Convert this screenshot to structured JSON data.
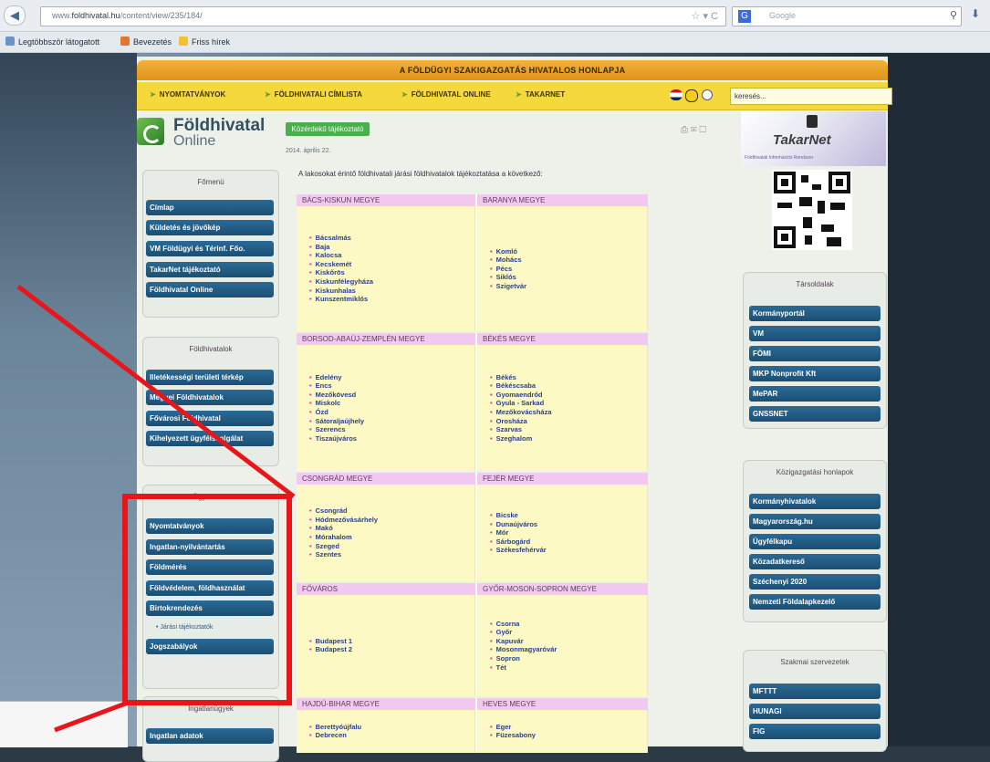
{
  "browser": {
    "back_icon": "back-arrow-icon",
    "url_prefix": "www.",
    "url_domain": "foldhivatal.hu",
    "url_path": "/content/view/235/184/",
    "search_placeholder": "Google",
    "search_engine_icon": "G",
    "bookmarks": [
      "Legtöbbször látogatott",
      "Bevezetés",
      "Friss hírek"
    ]
  },
  "site": {
    "banner": "A FÖLDÜGYI SZAKIGAZGATÁS HIVATALOS HONLAPJA",
    "menu": [
      "NYOMTATVÁNYOK",
      "FÖLDHIVATALI CÍMLISTA",
      "FÖLDHIVATAL ONLINE",
      "TAKARNET"
    ],
    "search_value": "keresés...",
    "logo": {
      "title": "Földhivatal",
      "subtitle": "Online"
    }
  },
  "left_sidebar": {
    "boxes": [
      {
        "title": "Főmenü",
        "items": [
          "Címlap",
          "Küldetés és jövőkép",
          "VM Földügyi és Térinf. Főo.",
          "TakarNet tájékoztató",
          "Földhivatal Online"
        ]
      },
      {
        "title": "Földhivatalok",
        "items": [
          "Illetékességi területi térkép",
          "Megyei Földhivatalok",
          "Fővárosi Földhivatal",
          "Kihelyezett ügyfélszolgálat"
        ]
      },
      {
        "title": "Ügyintézés",
        "items": [
          "Nyomtatványok",
          "Ingatlan-nyilvántartás",
          "Földmérés",
          "Földvédelem, földhasználat",
          "Birtokrendezés",
          "Jogszabályok"
        ],
        "sub_link": "Járási tájékoztatók",
        "sub_after_index": 4
      },
      {
        "title": "Ingatlanügyek",
        "items": [
          "Ingatlan adatok"
        ]
      }
    ]
  },
  "main": {
    "tag": "Közérdekű tájékoztató",
    "date": "2014. április 22.",
    "intro": "A lakosokat érintő földhivatali járási földhivatalok tájékoztatása a következő:",
    "counties": [
      {
        "left": {
          "name": "BÁCS-KISKUN MEGYE",
          "towns": [
            "Bácsalmás",
            "Baja",
            "Kalocsa",
            "Kecskemét",
            "Kiskőrös",
            "Kiskunfélegyháza",
            "Kiskunhalas",
            "Kunszentmiklós"
          ]
        },
        "right": {
          "name": "BARANYA MEGYE",
          "towns": [
            "Komló",
            "Mohács",
            "Pécs",
            "Siklós",
            "Szigetvár"
          ]
        }
      },
      {
        "left": {
          "name": "BORSOD-ABAÚJ-ZEMPLÉN MEGYE",
          "towns": [
            "Edelény",
            "Encs",
            "Mezőkövesd",
            "Miskolc",
            "Ózd",
            "Sátoraljaújhely",
            "Szerencs",
            "Tiszaújváros"
          ]
        },
        "right": {
          "name": "BÉKÉS MEGYE",
          "towns": [
            "Békés",
            "Békéscsaba",
            "Gyomaendrőd",
            "Gyula - Sarkad",
            "Mezőkovácsháza",
            "Orosháza",
            "Szarvas",
            "Szeghalom"
          ]
        }
      },
      {
        "left": {
          "name": "CSONGRÁD MEGYE",
          "towns": [
            "Csongrád",
            "Hódmezővásárhely",
            "Makó",
            "Mórahalom",
            "Szeged",
            "Szentes"
          ]
        },
        "right": {
          "name": "FEJÉR MEGYE",
          "towns": [
            "Bicske",
            "Dunaújváros",
            "Mór",
            "Sárbogárd",
            "Székesfehérvár"
          ]
        }
      },
      {
        "left": {
          "name": "FŐVÁROS",
          "towns": [
            "Budapest 1",
            "Budapest 2"
          ]
        },
        "right": {
          "name": "GYŐR-MOSON-SOPRON MEGYE",
          "towns": [
            "Csorna",
            "Győr",
            "Kapuvár",
            "Mosonmagyaróvár",
            "Sopron",
            "Tét"
          ]
        }
      },
      {
        "left": {
          "name": "HAJDÚ-BIHAR MEGYE",
          "towns": [
            "Berettyóújfalu",
            "Debrecen"
          ]
        },
        "right": {
          "name": "HEVES MEGYE",
          "towns": [
            "Eger",
            "Füzesabony"
          ]
        }
      }
    ]
  },
  "right_sidebar": {
    "takarnet_title": "TakarNet",
    "takarnet_sub": "Földhivatali Információs Rendszer",
    "boxes": [
      {
        "title": "Társoldalak",
        "items": [
          "Kormányportál",
          "VM",
          "FÖMI",
          "MKP Nonprofit Kft",
          "MePAR",
          "GNSSNET"
        ]
      },
      {
        "title": "Közigazgatási honlapok",
        "items": [
          "Kormányhivatalok",
          "Magyarország.hu",
          "Ügyfélkapu",
          "Közadatkereső",
          "Széchenyi 2020",
          "Nemzeti Földalapkezelő"
        ]
      },
      {
        "title": "Szakmai szervezetek",
        "items": [
          "MFTTT",
          "HUNAGI",
          "FIG"
        ]
      }
    ]
  }
}
